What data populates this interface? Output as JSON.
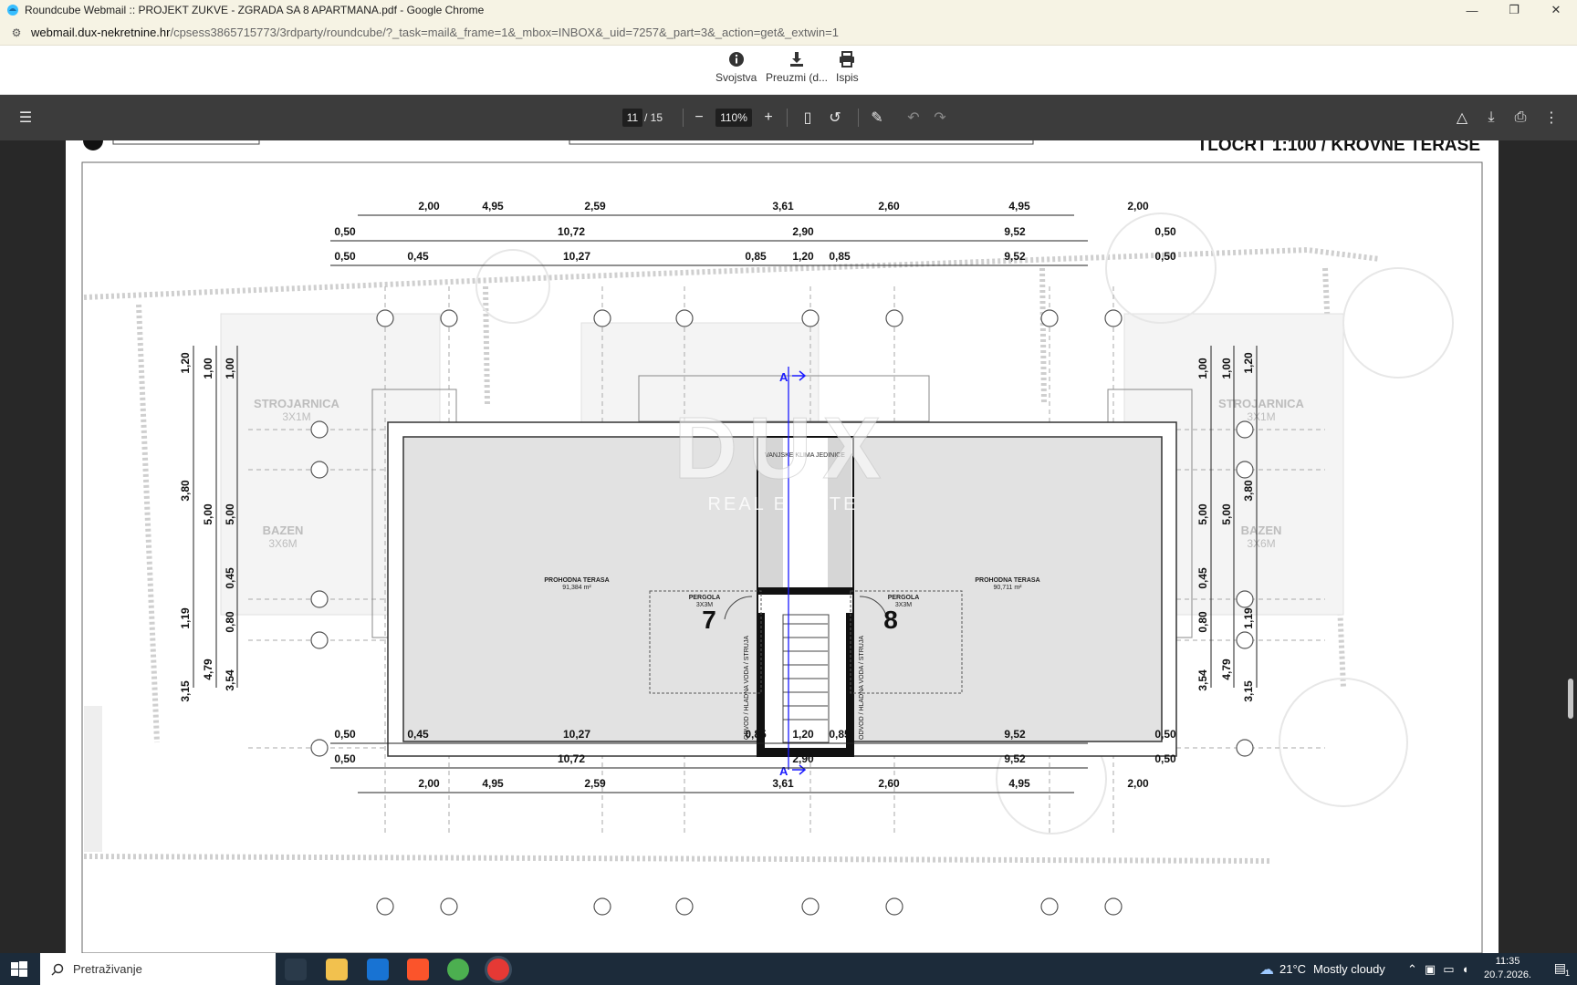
{
  "window": {
    "title": "Roundcube Webmail :: PROJEKT ZUKVE - ZGRADA SA 8 APARTMANA.pdf - Google Chrome",
    "url_host": "webmail.dux-nekretnine.hr",
    "url_path": "/cpsess3865715773/3rdparty/roundcube/?_task=mail&_frame=1&_mbox=INBOX&_uid=7257&_part=3&_action=get&_extwin=1"
  },
  "toolbar": {
    "properties_label": "Svojstva",
    "download_label": "Preuzmi (d...",
    "print_label": "Ispis"
  },
  "pdf": {
    "current_page": "11",
    "page_total": "/ 15",
    "zoom": "110%"
  },
  "drawing": {
    "sheet_title": "TLOCRT 1:100 / KROVNE TERASE",
    "top_dims_row1": [
      "2,00",
      "4,95",
      "2,59",
      "3,61",
      "2,60",
      "4,95",
      "2,00"
    ],
    "top_dims_row2": [
      "0,50",
      "10,72",
      "2,90",
      "9,52",
      "0,50"
    ],
    "top_dims_row3": [
      "0,50",
      "0,45",
      "10,27",
      "0,85",
      "1,20",
      "0,85",
      "9,52",
      "0,50"
    ],
    "left_dims_outer": [
      "1,20",
      "3,80",
      "1,19",
      "3,15"
    ],
    "left_dims_mid": [
      "1,00",
      "5,00",
      "4,79"
    ],
    "left_dims_inner": [
      "1,00",
      "5,00",
      "0,45",
      "0,80",
      "3,54"
    ],
    "room_machine_left": "STROJARNICA",
    "room_machine_left_size": "3X1M",
    "room_machine_right": "STROJARNICA",
    "room_machine_right_size": "3X1M",
    "pool_left": "BAZEN",
    "pool_left_size": "3X6M",
    "pool_right": "BAZEN",
    "pool_right_size": "3X6M",
    "terrace_left": "PROHODNA TERASA",
    "terrace_left_area": "91,384 m²",
    "terrace_right": "PROHODNA TERASA",
    "terrace_right_area": "90,711 m²",
    "pergola": "PERGOLA",
    "pergola_size": "3X3M",
    "apt_left": "7",
    "apt_right": "8",
    "ac_units": "VANJSKE KLIMA JEDINICE",
    "section_mark": "A",
    "drain_label": "ODVOD / HLADNA VODA / STRUJA",
    "watermark": "DUX",
    "watermark_sub": "REAL ESTATE"
  },
  "taskbar": {
    "search_placeholder": "Pretraživanje",
    "weather_temp": "21°C",
    "weather_desc": "Mostly cloudy",
    "time": "11:35",
    "date": "20.7.2026.",
    "notification_count": "1"
  }
}
